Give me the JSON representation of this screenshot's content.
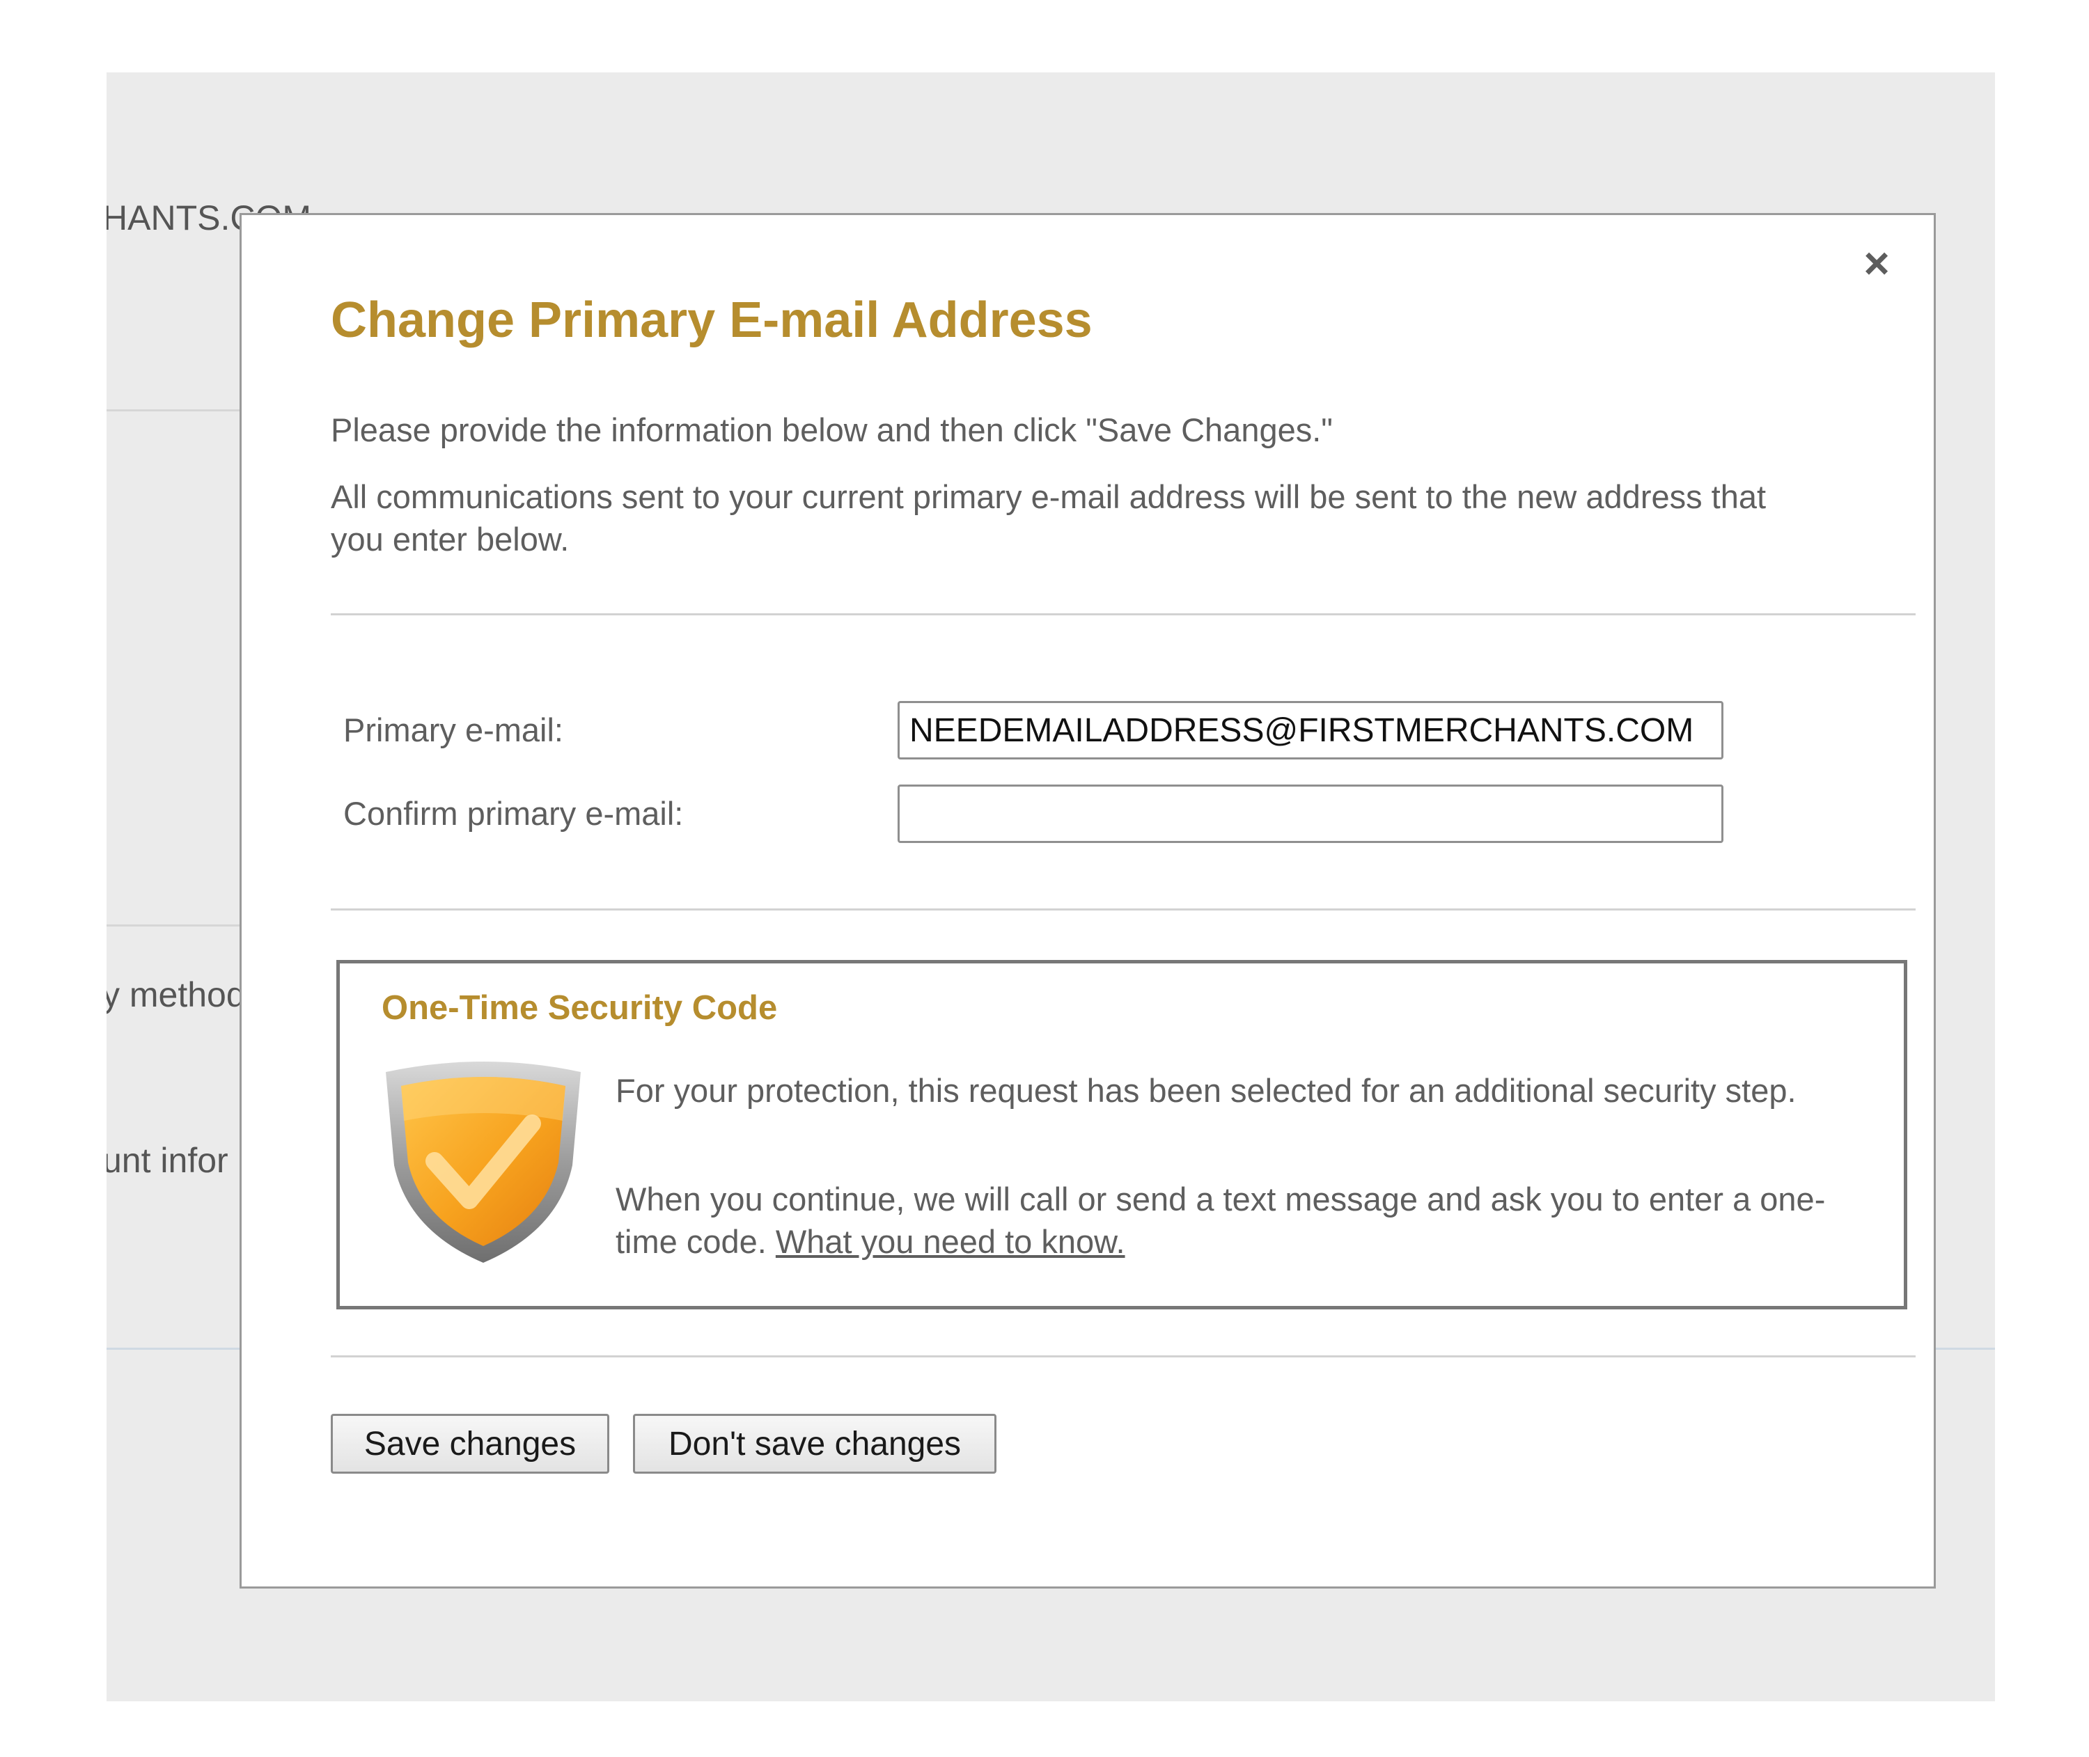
{
  "background": {
    "email_fragment": "HANTS.COM",
    "method_fragment": "y method",
    "account_fragment": "unt infor"
  },
  "modal": {
    "close_glyph": "×",
    "title": "Change Primary E-mail Address",
    "intro": "Please provide the information below and then click \"Save Changes.\"",
    "notice": "All communications sent to your current primary e-mail address will be sent to the new address that you enter below."
  },
  "form": {
    "primary_label": "Primary e-mail:",
    "primary_value": "NEEDEMAILADDRESS@FIRSTMERCHANTS.COM",
    "confirm_label": "Confirm primary e-mail:",
    "confirm_value": ""
  },
  "security": {
    "title": "One-Time Security Code",
    "icon": "shield-check-icon",
    "para1": "For your protection, this request has been selected for an additional security step.",
    "para2": "When you continue, we will call or send a text message and ask you to enter a one-time code.",
    "link": "What you need to know."
  },
  "buttons": {
    "save": "Save changes",
    "dont_save": "Don't save changes"
  },
  "colors": {
    "accent": "#b68d2e",
    "text": "#5e5e5e",
    "shield_orange": "#f5a623",
    "shield_rim": "#a9a9a9",
    "backdrop": "#ebebeb"
  }
}
